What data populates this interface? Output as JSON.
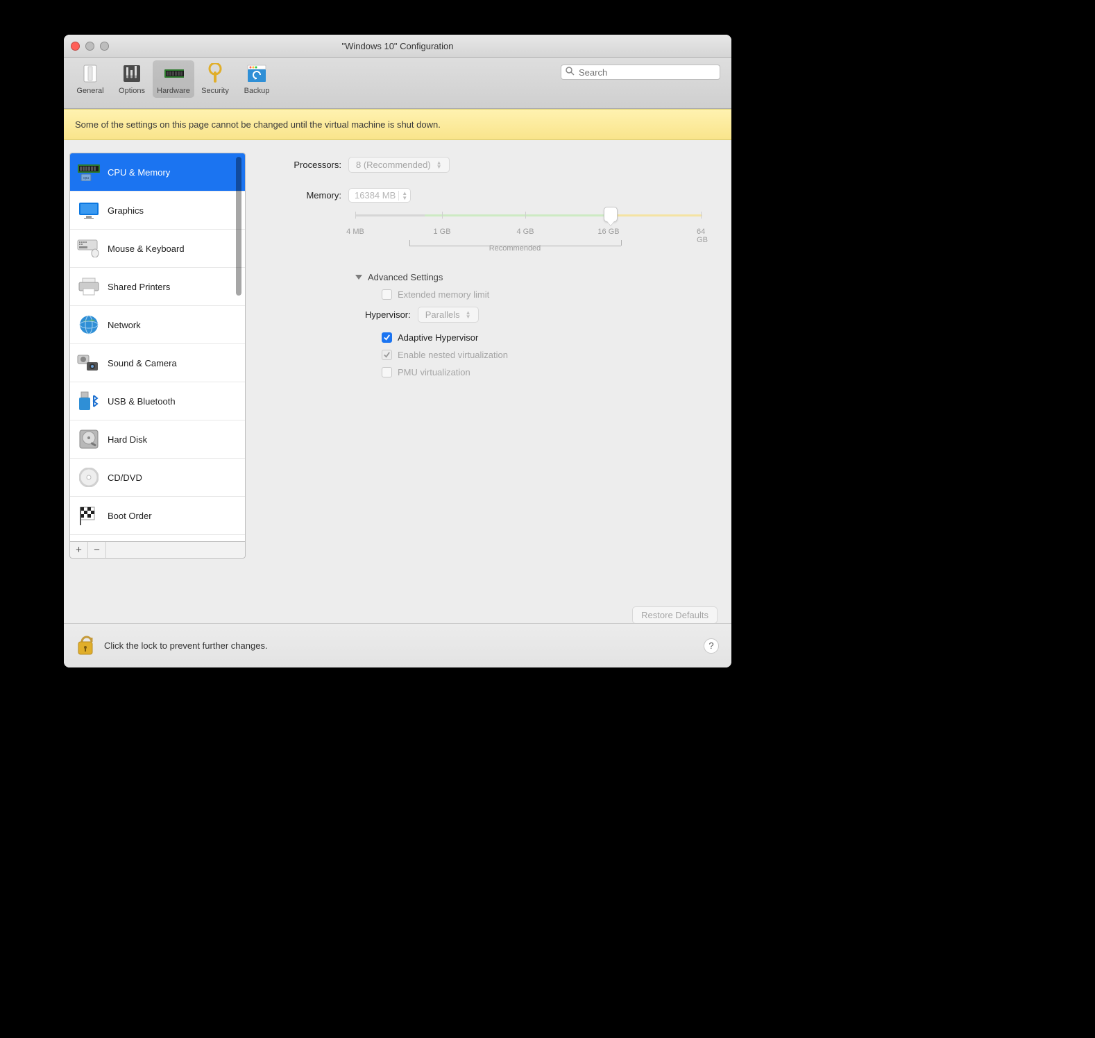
{
  "window": {
    "title": "\"Windows 10\" Configuration"
  },
  "toolbar": {
    "items": [
      {
        "label": "General"
      },
      {
        "label": "Options"
      },
      {
        "label": "Hardware"
      },
      {
        "label": "Security"
      },
      {
        "label": "Backup"
      }
    ],
    "search_placeholder": "Search"
  },
  "banner": {
    "text": "Some of the settings on this page cannot be changed until the virtual machine is shut down."
  },
  "sidebar": {
    "items": [
      {
        "label": "CPU & Memory",
        "selected": true
      },
      {
        "label": "Graphics"
      },
      {
        "label": "Mouse & Keyboard"
      },
      {
        "label": "Shared Printers"
      },
      {
        "label": "Network"
      },
      {
        "label": "Sound & Camera"
      },
      {
        "label": "USB & Bluetooth"
      },
      {
        "label": "Hard Disk"
      },
      {
        "label": "CD/DVD"
      },
      {
        "label": "Boot Order"
      }
    ]
  },
  "content": {
    "processors_label": "Processors:",
    "processors_value": "8 (Recommended)",
    "memory_label": "Memory:",
    "memory_value": "16384 MB",
    "memory_ticks": [
      "4 MB",
      "1 GB",
      "4 GB",
      "16 GB",
      "64 GB"
    ],
    "memory_recommended_label": "Recommended",
    "advanced_label": "Advanced Settings",
    "ext_mem_label": "Extended memory limit",
    "hypervisor_label": "Hypervisor:",
    "hypervisor_value": "Parallels",
    "adaptive_label": "Adaptive Hypervisor",
    "nested_label": "Enable nested virtualization",
    "pmu_label": "PMU virtualization",
    "restore_label": "Restore Defaults"
  },
  "footer": {
    "lock_text": "Click the lock to prevent further changes.",
    "help": "?"
  }
}
